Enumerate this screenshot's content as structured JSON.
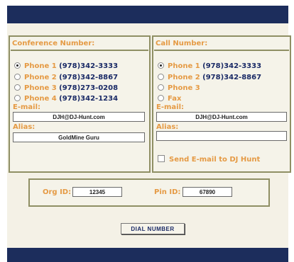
{
  "conference": {
    "header": "Conference Number:",
    "phones": [
      {
        "label": "Phone 1",
        "number": "(978)342-3333",
        "selected": true
      },
      {
        "label": "Phone 2",
        "number": "(978)342-8867",
        "selected": false
      },
      {
        "label": "Phone 3",
        "number": "(978)273-0208",
        "selected": false
      },
      {
        "label": "Phone 4",
        "number": "(978)342-1234",
        "selected": false
      }
    ],
    "email_label": "E-mail:",
    "email_value": "DJH@DJ-Hunt.com",
    "alias_label": "Alias:",
    "alias_value": "GoldMine Guru"
  },
  "call": {
    "header": "Call Number:",
    "phones": [
      {
        "label": "Phone 1",
        "number": "(978)342-3333",
        "selected": true
      },
      {
        "label": "Phone 2",
        "number": "(978)342-8867",
        "selected": false
      },
      {
        "label": "Phone 3",
        "number": "",
        "selected": false
      },
      {
        "label": "Fax",
        "number": "",
        "selected": false
      }
    ],
    "email_label": "E-mail:",
    "email_value": "DJH@DJ-Hunt.com",
    "alias_label": "Alias:",
    "alias_value": "",
    "send_email_label": "Send E-mail to DJ Hunt"
  },
  "ids": {
    "org_label": "Org ID:",
    "org_value": "12345",
    "pin_label": "Pin ID:",
    "pin_value": "67890"
  },
  "dial_button": "Dial Number",
  "colors": {
    "navy_bar": "#1c2d5c",
    "accent_orange": "#e59a44",
    "number_navy": "#1a2a66",
    "background": "#f4f1e6"
  }
}
